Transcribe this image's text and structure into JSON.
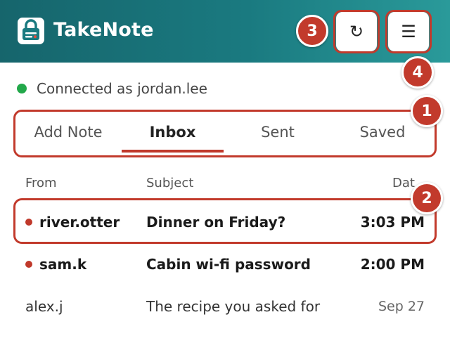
{
  "app": {
    "title": "TakeNote",
    "refresh_icon": "↻",
    "menu_icon": "☰"
  },
  "status": {
    "text": "Connected as jordan.lee",
    "color": "#22a84a"
  },
  "tabs": [
    {
      "label": "Add Note",
      "active": false
    },
    {
      "label": "Inbox",
      "active": true
    },
    {
      "label": "Sent",
      "active": false
    },
    {
      "label": "Saved",
      "active": false
    }
  ],
  "table": {
    "columns": [
      "From",
      "Subject",
      "Dat"
    ],
    "rows": [
      {
        "from": "river.otter",
        "subject": "Dinner on Friday?",
        "date": "3:03 PM",
        "unread": true
      },
      {
        "from": "sam.k",
        "subject": "Cabin wi-fi password",
        "date": "2:00 PM",
        "unread": true
      },
      {
        "from": "alex.j",
        "subject": "The recipe you asked for",
        "date": "Sep 27",
        "unread": false
      }
    ]
  },
  "annotations": [
    "1",
    "2",
    "3",
    "4"
  ],
  "colors": {
    "header_start": "#16656c",
    "header_end": "#2a9a9a",
    "accent": "#c0392b",
    "annotation": "#c23a2c"
  }
}
